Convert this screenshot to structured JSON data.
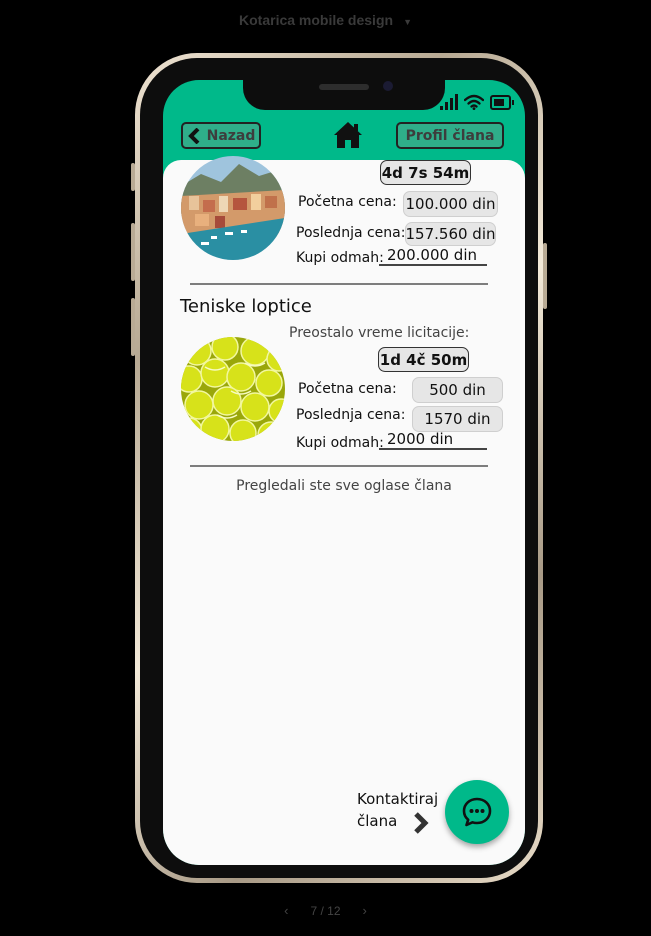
{
  "app_title": "Kotarica mobile design",
  "header": {
    "back_label": "Nazad",
    "profile_label": "Profil člana"
  },
  "listings": [
    {
      "timer": "4d 7s 54m",
      "start_price_label": "Početna cena:",
      "start_price": "100.000 din",
      "last_price_label": "Poslednja cena:",
      "last_price": "157.560 din",
      "buy_now_label": "Kupi odmah:",
      "buy_now_price": "200.000 din"
    },
    {
      "title": "Teniske loptice",
      "remaining_label": "Preostalo vreme licitacije:",
      "timer": "1d 4č 50m",
      "start_price_label": "Početna cena:",
      "start_price": "500 din",
      "last_price_label": "Poslednja cena:",
      "last_price": "1570 din",
      "buy_now_label": "Kupi odmah:",
      "buy_now_price": "2000 din"
    }
  ],
  "footer_note": "Pregledali ste sve oglase člana",
  "contact": {
    "line1": "Kontaktiraj",
    "line2": "člana"
  },
  "pager": "7 / 12",
  "colors": {
    "accent": "#00b98a",
    "background": "#000000",
    "content": "#fafafa"
  }
}
